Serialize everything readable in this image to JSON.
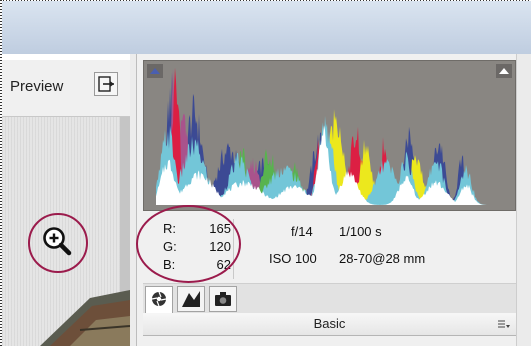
{
  "toolbar": {
    "preview_label": "Preview",
    "toggle_icon": "before-after-toggle-icon"
  },
  "canvas": {
    "zoom_icon": "zoom-in-magnifier-icon"
  },
  "histogram": {
    "shadow_clip_icon": "shadow-clipping-warning-icon",
    "highlight_clip_icon": "highlight-clipping-warning-icon",
    "colors": {
      "background": "#898682",
      "white": "#ffffff",
      "cyan": "#73c6d8",
      "yellow": "#ece81d",
      "red": "#dc1f43",
      "blue": "#3c4a94",
      "green": "#58b34e",
      "magenta": "#a9538c"
    }
  },
  "readout": {
    "r_label": "R:",
    "r_value": "165",
    "g_label": "G:",
    "g_value": "120",
    "b_label": "B:",
    "b_value": "62"
  },
  "camera": {
    "aperture": "f/14",
    "shutter": "1/100 s",
    "iso": "ISO 100",
    "lens": "28-70@28 mm"
  },
  "tabs": [
    {
      "icon": "basic-aperture-icon",
      "active": true
    },
    {
      "icon": "tone-curve-icon",
      "active": false
    },
    {
      "icon": "camera-icon",
      "active": false
    }
  ],
  "panel": {
    "section_title": "Basic",
    "menu_icon": "panel-menu-icon"
  },
  "highlight_color": "#9b1b4c"
}
